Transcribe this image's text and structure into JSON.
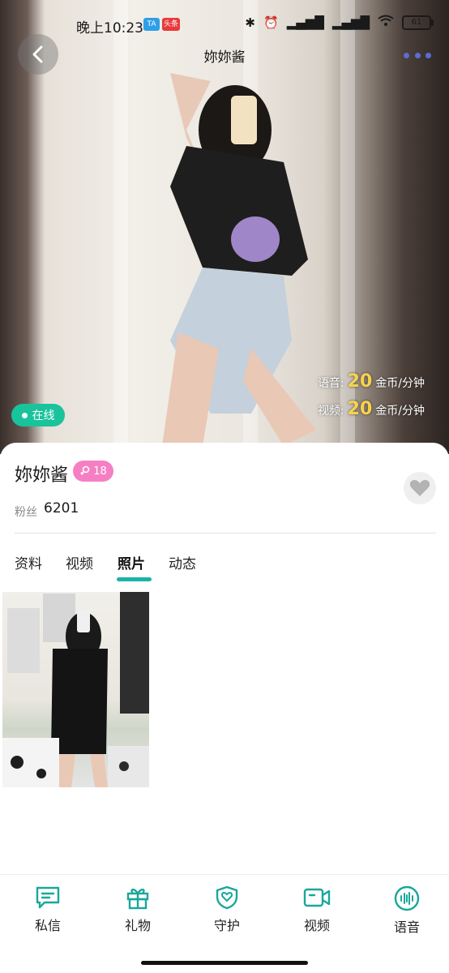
{
  "status_bar": {
    "time": "晚上10:23",
    "badge_1": "TA",
    "badge_2": "头条",
    "battery": "61"
  },
  "nav": {
    "title": "妳妳酱"
  },
  "pricing": {
    "voice_label": "语音:",
    "voice_price": "20",
    "voice_unit": "金币/分钟",
    "video_label": "视频:",
    "video_price": "20",
    "video_unit": "金币/分钟"
  },
  "online_status": "在线",
  "profile": {
    "name": "妳妳酱",
    "level": "18",
    "fans_label": "粉丝",
    "fans_count": "6201"
  },
  "tabs": [
    {
      "label": "资料",
      "active": false
    },
    {
      "label": "视频",
      "active": false
    },
    {
      "label": "照片",
      "active": true
    },
    {
      "label": "动态",
      "active": false
    }
  ],
  "bottom_actions": [
    {
      "label": "私信",
      "icon": "chat-icon"
    },
    {
      "label": "礼物",
      "icon": "gift-icon"
    },
    {
      "label": "守护",
      "icon": "shield-heart-icon"
    },
    {
      "label": "视频",
      "icon": "video-camera-icon"
    },
    {
      "label": "语音",
      "icon": "voice-wave-icon"
    }
  ],
  "colors": {
    "accent": "#19b3a8",
    "online": "#19c39c",
    "level_badge": "#f67fc4",
    "price_highlight": "#f8d24a",
    "more_dots": "#5b6bd6"
  }
}
